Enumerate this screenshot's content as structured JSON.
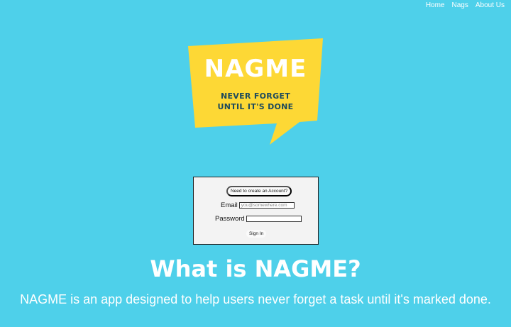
{
  "nav": {
    "items": [
      {
        "label": "Home"
      },
      {
        "label": "Nags"
      },
      {
        "label": "About Us"
      }
    ]
  },
  "logo": {
    "title": "NAGME",
    "tagline_line1": "NEVER FORGET",
    "tagline_line2": "UNTIL IT'S DONE"
  },
  "login": {
    "create_account_label": "Need to create an Account?",
    "email_label": "Email",
    "email_placeholder": "you@somewhere.com",
    "email_value": "",
    "password_label": "Password",
    "password_value": "",
    "signin_label": "Sign In"
  },
  "about": {
    "heading": "What is NAGME?",
    "description": "NAGME is an app designed to help users never forget a task until it's marked done."
  },
  "colors": {
    "background": "#4ed0ea",
    "logo_bubble": "#fdd835",
    "logo_title": "#ffffff",
    "logo_tagline": "#1d4a5c",
    "text_light": "#ffffff"
  }
}
